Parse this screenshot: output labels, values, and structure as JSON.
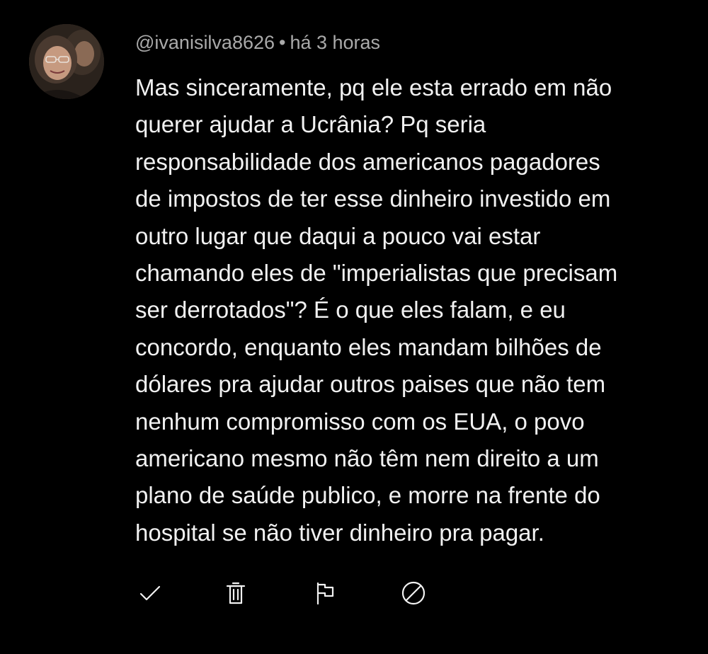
{
  "comment": {
    "author": "@ivanisilva8626",
    "separator": "•",
    "timestamp": "há 3 horas",
    "text_lines": [
      "Mas sinceramente, pq ele esta errado em não",
      "querer ajudar a Ucrânia? Pq seria",
      "responsabilidade dos americanos pagadores",
      "de impostos de ter esse dinheiro investido em",
      "outro lugar que daqui a pouco vai estar",
      "chamando eles de \"imperialistas que precisam",
      "ser derrotados\"? É o que eles falam, e eu",
      "concordo, enquanto eles mandam bilhões de",
      "dólares pra ajudar outros paises que não tem",
      "nenhum compromisso com os EUA, o povo",
      "americano mesmo não têm nem direito a um",
      "plano de saúde publico, e morre na frente do",
      "hospital se não tiver dinheiro pra pagar."
    ]
  },
  "actions": [
    {
      "name": "approve-button",
      "icon": "check-icon"
    },
    {
      "name": "remove-button",
      "icon": "trash-icon"
    },
    {
      "name": "report-button",
      "icon": "flag-icon"
    },
    {
      "name": "block-button",
      "icon": "block-icon"
    }
  ],
  "colors": {
    "background": "#000000",
    "text": "#f1f1f1",
    "meta": "#aaaaaa"
  }
}
